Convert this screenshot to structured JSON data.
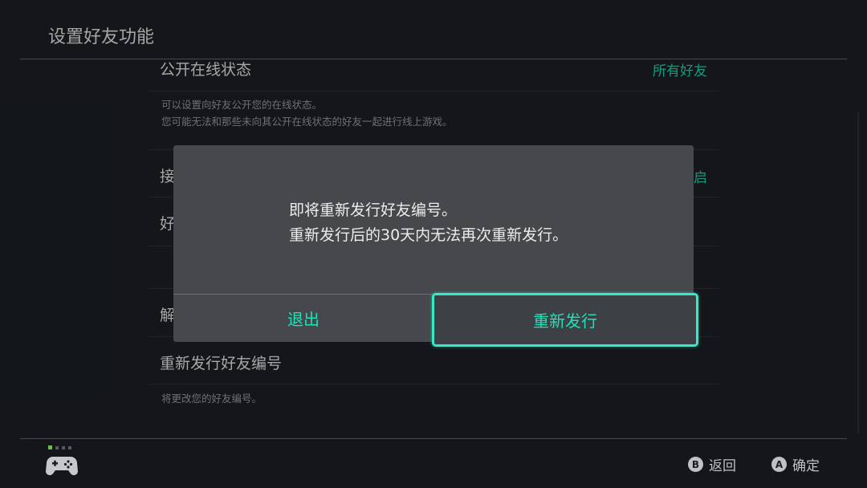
{
  "header": {
    "title": "设置好友功能"
  },
  "settings": {
    "online_status": {
      "title": "公开在线状态",
      "value": "所有好友",
      "description": [
        "可以设置向好友公开您的在线状态。",
        "您可能无法和那些未向其公开在线状态的好友一起进行线上游戏。"
      ]
    },
    "row2": {
      "title_visible": "接",
      "value_visible": "启"
    },
    "row3": {
      "title_visible": "好"
    },
    "row4": {
      "title_visible": "解"
    },
    "reissue": {
      "title": "重新发行好友编号",
      "description": "将更改您的好友编号。"
    }
  },
  "dialog": {
    "message": [
      "即将重新发行好友编号。",
      "重新发行后的30天内无法再次重新发行。"
    ],
    "exit_label": "退出",
    "confirm_label": "重新发行"
  },
  "footer": {
    "back": {
      "key": "B",
      "label": "返回"
    },
    "ok": {
      "key": "A",
      "label": "确定"
    }
  },
  "colors": {
    "accent": "#19c7a4",
    "focus_border": "#35e9c9",
    "background": "#1a1d21",
    "dialog": "#46484b"
  },
  "icons": {
    "controller": "gamepad-icon"
  }
}
